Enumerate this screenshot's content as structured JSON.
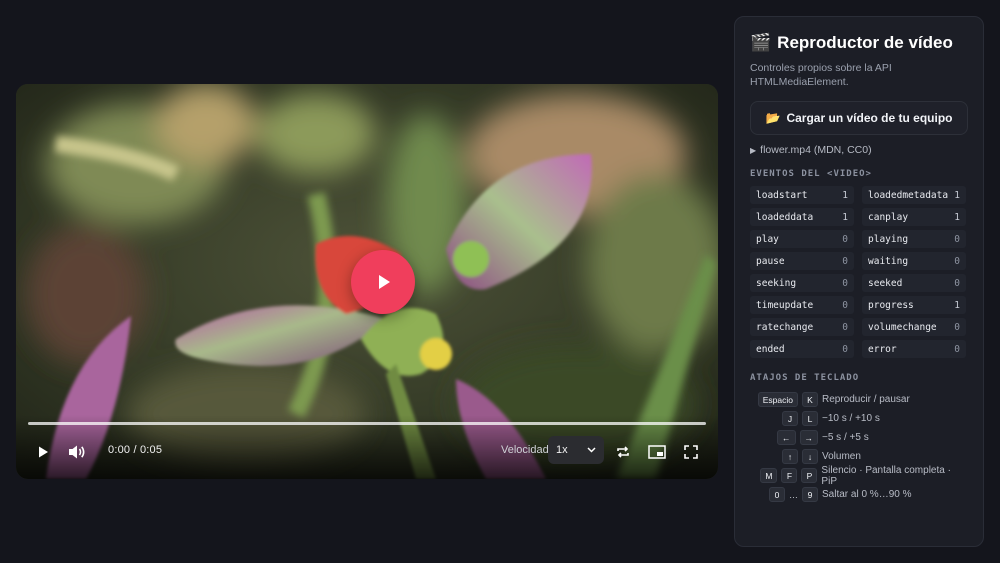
{
  "player": {
    "time": "0:00 / 0:05",
    "progress": 0,
    "speed_label": "Velocidad",
    "speed_value": "1x",
    "icons": {
      "play": "play-icon",
      "volume": "volume-icon",
      "loop": "loop-icon",
      "pip": "picture-in-picture-icon",
      "fullscreen": "fullscreen-icon",
      "big_play": "play-icon"
    }
  },
  "panel": {
    "emoji": "🎬",
    "title": "Reproductor de vídeo",
    "subtitle": "Controles propios sobre la API HTMLMediaElement.",
    "load_emoji": "📂",
    "load_label": "Cargar un vídeo de tu equipo",
    "file_arrow": "▶",
    "file_label": "flower.mp4 (MDN, CC0)",
    "events_heading": "EVENTOS DEL <VIDEO>",
    "events": [
      {
        "name": "loadstart",
        "count": "1"
      },
      {
        "name": "loadedmetadata",
        "count": "1"
      },
      {
        "name": "loadeddata",
        "count": "1"
      },
      {
        "name": "canplay",
        "count": "1"
      },
      {
        "name": "play",
        "count": "0"
      },
      {
        "name": "playing",
        "count": "0"
      },
      {
        "name": "pause",
        "count": "0"
      },
      {
        "name": "waiting",
        "count": "0"
      },
      {
        "name": "seeking",
        "count": "0"
      },
      {
        "name": "seeked",
        "count": "0"
      },
      {
        "name": "timeupdate",
        "count": "0"
      },
      {
        "name": "progress",
        "count": "1"
      },
      {
        "name": "ratechange",
        "count": "0"
      },
      {
        "name": "volumechange",
        "count": "0"
      },
      {
        "name": "ended",
        "count": "0"
      },
      {
        "name": "error",
        "count": "0"
      }
    ],
    "shortcuts_heading": "ATAJOS DE TECLADO",
    "shortcuts": [
      {
        "keys": [
          "Espacio",
          "K"
        ],
        "desc": "Reproducir / pausar"
      },
      {
        "keys": [
          "J",
          "L"
        ],
        "desc": "−10 s / +10 s"
      },
      {
        "keys": [
          "←",
          "→"
        ],
        "desc": "−5 s / +5 s"
      },
      {
        "keys": [
          "↑",
          "↓"
        ],
        "desc": "Volumen"
      },
      {
        "keys": [
          "M",
          "F",
          "P"
        ],
        "desc": "Silencio · Pantalla completa · PiP"
      },
      {
        "keys": [
          "0",
          "…",
          "9"
        ],
        "desc": "Saltar al 0 %…90 %"
      }
    ]
  },
  "colors": {
    "accent": "#f03e5c",
    "background": "#14151c",
    "panel": "#1c1e26"
  }
}
